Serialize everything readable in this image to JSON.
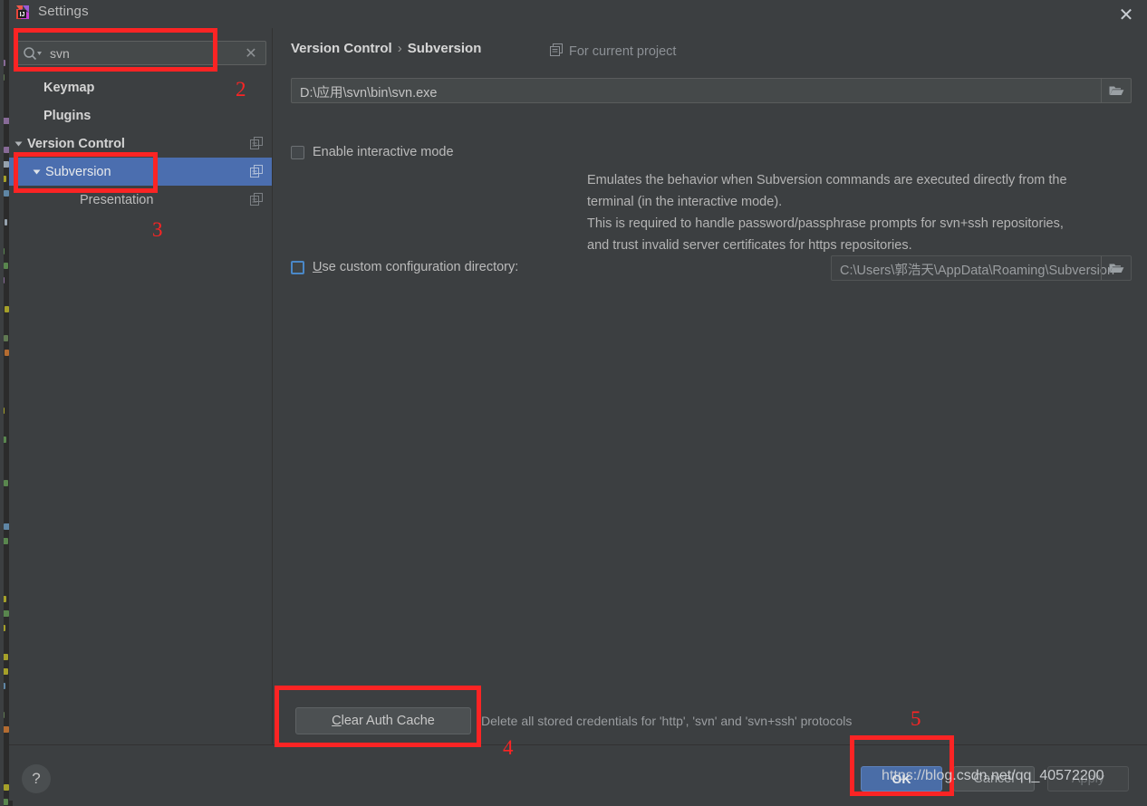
{
  "window": {
    "title": "Settings",
    "close_label": "✕",
    "app_icon": "intellij-idea-icon"
  },
  "sidebar": {
    "search": {
      "value": "svn",
      "placeholder": "",
      "icon": "search-icon",
      "clear_label": "✕"
    },
    "items": [
      {
        "label": "Keymap",
        "bold": true,
        "arrow": false,
        "selected": false,
        "indent": 38,
        "copy": false
      },
      {
        "label": "Plugins",
        "bold": true,
        "arrow": false,
        "selected": false,
        "indent": 38,
        "copy": false
      },
      {
        "label": "Version Control",
        "bold": true,
        "arrow": true,
        "selected": false,
        "indent": 18,
        "copy": true
      },
      {
        "label": "Subversion",
        "bold": false,
        "arrow": true,
        "selected": true,
        "indent": 38,
        "copy": true
      },
      {
        "label": "Presentation",
        "bold": false,
        "arrow": false,
        "selected": false,
        "indent": 78,
        "copy": true
      }
    ]
  },
  "main": {
    "breadcrumb": {
      "root": "Version Control",
      "separator": "›",
      "leaf": "Subversion"
    },
    "scope": {
      "icon": "project-scope-icon",
      "label": "For current project"
    },
    "svn_path": {
      "value": "D:\\应用\\svn\\bin\\svn.exe",
      "browse_icon": "folder-icon"
    },
    "interactive": {
      "label": "Enable interactive mode",
      "checked": false
    },
    "description": "Emulates the behavior when Subversion commands are executed directly from the\nterminal (in the interactive mode).\nThis is required to handle password/passphrase prompts for svn+ssh repositories,\nand trust invalid server certificates for https repositories.",
    "custom_config": {
      "label_prefix": "U",
      "label_rest": "se custom configuration directory:",
      "checked": false,
      "value": "C:\\Users\\郭浩天\\AppData\\Roaming\\Subversion"
    },
    "clear_auth": {
      "label_prefix": "C",
      "label_rest": "lear Auth Cache",
      "note": "Delete all stored credentials for 'http', 'svn' and 'svn+ssh' protocols"
    }
  },
  "footer": {
    "help_label": "?",
    "ok_label": "OK",
    "cancel_label": "Cancel",
    "apply_label": "Apply"
  },
  "annotations": {
    "n2": "2",
    "n3": "3",
    "n4": "4",
    "n5": "5",
    "color": "#fb2424"
  },
  "watermark": "https://blog.csdn.net/qq_40572200"
}
